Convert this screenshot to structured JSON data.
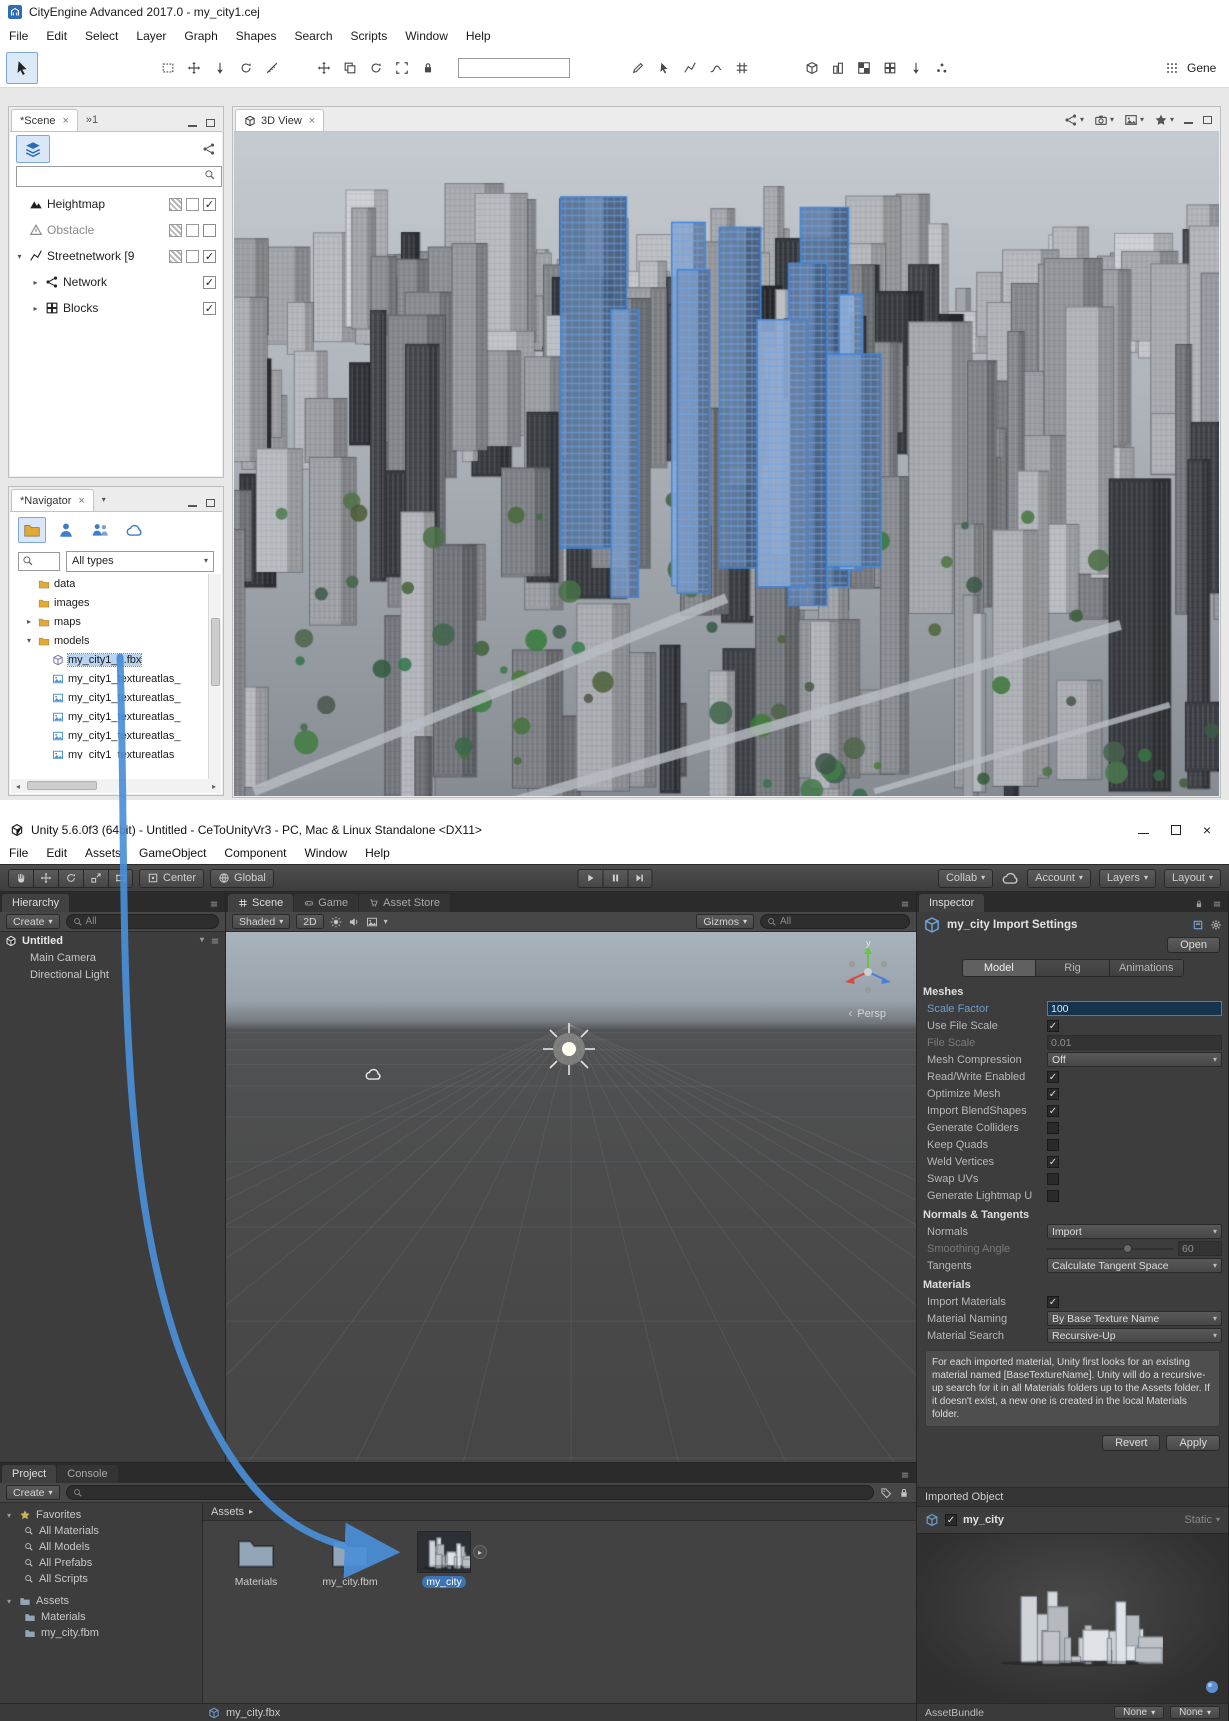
{
  "colors": {
    "arrow": "#4a8fd6",
    "unity_selection": "#3e74b4",
    "ce_selection": "#b8d4f2"
  },
  "cityengine": {
    "title": "CityEngine Advanced 2017.0 - my_city1.cej",
    "menus": [
      "File",
      "Edit",
      "Select",
      "Layer",
      "Graph",
      "Shapes",
      "Search",
      "Scripts",
      "Window",
      "Help"
    ],
    "toolbar": {
      "groups": [
        [
          "marquee-select-icon",
          "move-tool-icon",
          "pull-down-icon",
          "rotate-tool-icon",
          "measure-icon"
        ],
        [
          "gizmo-move-icon",
          "duplicate-icon",
          "gizmo-rotate-icon",
          "frame-selection-icon",
          "lock-icon"
        ],
        [
          "draw-street-icon",
          "select-cursor-icon",
          "edit-street-icon",
          "curve-street-icon",
          "grid-street-icon"
        ],
        [
          "generate-model-icon",
          "building-tool-icon",
          "texture-tool-icon",
          "group-tool-icon",
          "align-tool-icon",
          "scatter-tool-icon"
        ]
      ],
      "partial_label": "Gene"
    },
    "scene_panel": {
      "tab_label": "*Scene",
      "tab_overflow": "»1",
      "search_value": "",
      "layers": [
        {
          "label": "Heightmap",
          "icon": "heightmap-icon",
          "expander": "",
          "indent": false,
          "dim": false,
          "swatches": true,
          "checked": true
        },
        {
          "label": "Obstacle",
          "icon": "obstacle-icon",
          "expander": "",
          "indent": false,
          "dim": true,
          "swatches": true,
          "checked": false
        },
        {
          "label": "Streetnetwork [9",
          "icon": "streetnetwork-icon",
          "expander": "v",
          "indent": false,
          "dim": false,
          "swatches": true,
          "checked": true
        },
        {
          "label": "Network",
          "icon": "network-icon",
          "expander": ">",
          "indent": true,
          "dim": false,
          "swatches": false,
          "checked": true
        },
        {
          "label": "Blocks",
          "icon": "blocks-icon",
          "expander": ">",
          "indent": true,
          "dim": false,
          "swatches": false,
          "checked": true
        }
      ]
    },
    "navigator": {
      "tab_label": "*Navigator",
      "filter_value": "All types",
      "tree": [
        {
          "label": "data",
          "icon": "folder-icon",
          "depth": 1,
          "expander": "",
          "selected": false
        },
        {
          "label": "images",
          "icon": "folder-icon",
          "depth": 1,
          "expander": "",
          "selected": false
        },
        {
          "label": "maps",
          "icon": "folder-icon",
          "depth": 1,
          "expander": ">",
          "selected": false
        },
        {
          "label": "models",
          "icon": "folder-icon",
          "depth": 1,
          "expander": "v",
          "selected": false
        },
        {
          "label": "my_city1_0.fbx",
          "icon": "model-file-icon",
          "depth": 2,
          "expander": "",
          "selected": true
        },
        {
          "label": "my_city1_textureatlas_",
          "icon": "image-file-icon",
          "depth": 2,
          "expander": "",
          "selected": false
        },
        {
          "label": "my_city1_textureatlas_",
          "icon": "image-file-icon",
          "depth": 2,
          "expander": "",
          "selected": false
        },
        {
          "label": "my_city1_textureatlas_",
          "icon": "image-file-icon",
          "depth": 2,
          "expander": "",
          "selected": false
        },
        {
          "label": "my_city1_textureatlas_",
          "icon": "image-file-icon",
          "depth": 2,
          "expander": "",
          "selected": false
        },
        {
          "label": "my_city1_textureatlas_",
          "icon": "image-file-icon",
          "depth": 2,
          "expander": "",
          "selected": false
        }
      ]
    },
    "viewport": {
      "tab_label": "3D View"
    }
  },
  "unity": {
    "title": "Unity 5.6.0f3 (64bit) - Untitled - CeToUnityVr3 - PC, Mac & Linux Standalone <DX11>",
    "menus": [
      "File",
      "Edit",
      "Assets",
      "GameObject",
      "Component",
      "Window",
      "Help"
    ],
    "toolbar": {
      "tools": [
        "hand-tool-icon",
        "move-tool-icon",
        "rotate-tool-icon",
        "scale-tool-icon",
        "rect-tool-icon"
      ],
      "center_label": "Center",
      "global_label": "Global",
      "collab_label": "Collab",
      "account_label": "Account",
      "layers_label": "Layers",
      "layout_label": "Layout"
    },
    "hierarchy": {
      "tab_label": "Hierarchy",
      "create_label": "Create",
      "search_hint": "All",
      "scene_name": "Untitled",
      "items": [
        "Main Camera",
        "Directional Light"
      ]
    },
    "scene_view": {
      "tabs": [
        "Scene",
        "Game",
        "Asset Store"
      ],
      "shaded_label": "Shaded",
      "mode_2d_label": "2D",
      "gizmos_label": "Gizmos",
      "search_hint": "All",
      "persp_label": "Persp",
      "axis_label": "y"
    },
    "inspector": {
      "tab_label": "Inspector",
      "header_title": "my_city Import Settings",
      "open_label": "Open",
      "tabs": [
        "Model",
        "Rig",
        "Animations"
      ],
      "active_tab": "Model",
      "sections": [
        {
          "title": "Meshes",
          "rows": [
            {
              "label": "Scale Factor",
              "type": "text",
              "value": "100",
              "focused": true,
              "accent": true
            },
            {
              "label": "Use File Scale",
              "type": "check",
              "value": true
            },
            {
              "label": "File Scale",
              "type": "text",
              "value": "0.01",
              "disabled": true
            },
            {
              "label": "Mesh Compression",
              "type": "dropdown",
              "value": "Off"
            },
            {
              "label": "Read/Write Enabled",
              "type": "check",
              "value": true
            },
            {
              "label": "Optimize Mesh",
              "type": "check",
              "value": true
            },
            {
              "label": "Import BlendShapes",
              "type": "check",
              "value": true
            },
            {
              "label": "Generate Colliders",
              "type": "check",
              "value": false
            },
            {
              "label": "Keep Quads",
              "type": "check",
              "value": false
            },
            {
              "label": "Weld Vertices",
              "type": "check",
              "value": true
            },
            {
              "label": "Swap UVs",
              "type": "check",
              "value": false
            },
            {
              "label": "Generate Lightmap U",
              "type": "check",
              "value": false
            }
          ]
        },
        {
          "title": "Normals & Tangents",
          "rows": [
            {
              "label": "Normals",
              "type": "dropdown",
              "value": "Import"
            },
            {
              "label": "Smoothing Angle",
              "type": "slider",
              "value": "60",
              "disabled": true
            },
            {
              "label": "Tangents",
              "type": "dropdown",
              "value": "Calculate Tangent Space"
            }
          ]
        },
        {
          "title": "Materials",
          "rows": [
            {
              "label": "Import Materials",
              "type": "check",
              "value": true
            },
            {
              "label": "Material Naming",
              "type": "dropdown",
              "value": "By Base Texture Name"
            },
            {
              "label": "Material Search",
              "type": "dropdown",
              "value": "Recursive-Up"
            }
          ]
        }
      ],
      "help_text": "For each imported material, Unity first looks for an existing material named [BaseTextureName]. Unity will do a recursive-up search for it in all Materials folders up to the Assets folder. If it doesn't exist, a new one is created in the local Materials folder.",
      "revert_label": "Revert",
      "apply_label": "Apply",
      "imported_object_label": "Imported Object",
      "object_name": "my_city",
      "static_label": "Static",
      "assetbundle_label": "AssetBundle",
      "assetbundle_value": "None",
      "assetbundle_variant": "None"
    },
    "project": {
      "tabs": [
        "Project",
        "Console"
      ],
      "create_label": "Create",
      "favorites_label": "Favorites",
      "favorites": [
        "All Materials",
        "All Models",
        "All Prefabs",
        "All Scripts"
      ],
      "assets_label": "Assets",
      "assets_children": [
        "Materials",
        "my_city.fbm"
      ],
      "breadcrumb": "Assets",
      "items": [
        {
          "label": "Materials",
          "type": "folder",
          "selected": false
        },
        {
          "label": "my_city.fbm",
          "type": "folder",
          "selected": false
        },
        {
          "label": "my_city",
          "type": "model",
          "selected": true
        }
      ],
      "status_file": "my_city.fbx"
    }
  }
}
